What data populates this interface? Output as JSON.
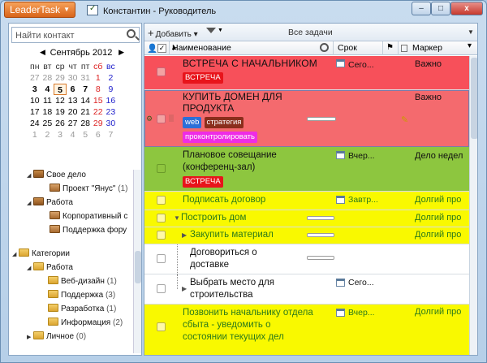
{
  "app": {
    "name": "LeaderTask",
    "window_title": "Константин - Руководитель"
  },
  "window_controls": {
    "minimize": "–",
    "maximize": "□",
    "close": "x"
  },
  "left_panel": {
    "search_placeholder": "Найти контакт",
    "calendar": {
      "month": "Сентябрь 2012",
      "weekdays": [
        "пн",
        "вт",
        "ср",
        "чт",
        "пт",
        "сб",
        "вс"
      ],
      "weeks": [
        [
          "27",
          "28",
          "29",
          "30",
          "31",
          "1",
          "2"
        ],
        [
          "3",
          "4",
          "5",
          "6",
          "7",
          "8",
          "9"
        ],
        [
          "10",
          "11",
          "12",
          "13",
          "14",
          "15",
          "16"
        ],
        [
          "17",
          "18",
          "19",
          "20",
          "21",
          "22",
          "23"
        ],
        [
          "24",
          "25",
          "26",
          "27",
          "28",
          "29",
          "30"
        ],
        [
          "1",
          "2",
          "3",
          "4",
          "5",
          "6",
          "7"
        ]
      ]
    },
    "tree": [
      {
        "label": "Свое дело",
        "count": ""
      },
      {
        "label": "Проект \"Янус\"",
        "count": "(1)"
      },
      {
        "label": "Работа",
        "count": ""
      },
      {
        "label": "Корпоративный с",
        "count": ""
      },
      {
        "label": "Поддержка фору",
        "count": ""
      },
      {
        "label": "Категории",
        "count": ""
      },
      {
        "label": "Работа",
        "count": ""
      },
      {
        "label": "Веб-дизайн",
        "count": "(1)"
      },
      {
        "label": "Поддержка",
        "count": "(3)"
      },
      {
        "label": "Разработка",
        "count": "(1)"
      },
      {
        "label": "Информация",
        "count": "(2)"
      },
      {
        "label": "Личное",
        "count": "(0)"
      }
    ]
  },
  "toolbar": {
    "add_label": "Добавить",
    "view_title": "Все задачи"
  },
  "columns": {
    "name": "Наименование",
    "due": "Срок",
    "marker": "Маркер"
  },
  "tasks": [
    {
      "title": "ВСТРЕЧА С НАЧАЛЬНИКОМ",
      "due": "Сего...",
      "marker": "Важно",
      "tags": [
        "ВСТРЕЧА"
      ]
    },
    {
      "title_line1": "КУПИТЬ ДОМЕН ДЛЯ",
      "title_line2": "ПРОДУКТА",
      "due": "",
      "marker": "Важно",
      "tags": [
        "web",
        "стратегия",
        "проконтролировать"
      ]
    },
    {
      "title_line1": "Плановое совещание",
      "title_line2": "(конференц-зал)",
      "due": "Вчер...",
      "marker": "Дело недел",
      "tags": [
        "ВСТРЕЧА"
      ]
    },
    {
      "title": "Подписать договор",
      "due": "Завтр...",
      "marker": "Долгий про"
    },
    {
      "title": "Построить дом",
      "due": "",
      "marker": "Долгий про"
    },
    {
      "title": "Закупить материал",
      "due": "",
      "marker": "Долгий про"
    },
    {
      "title_line1": "Договориться о",
      "title_line2": "доставке",
      "due": "",
      "marker": ""
    },
    {
      "title_line1": "Выбрать место для",
      "title_line2": "строительства",
      "due": "Сего...",
      "marker": ""
    },
    {
      "title_line1": "Позвонить начальнику отдела",
      "title_line2": "сбыта - уведомить о",
      "title_line3": "состоянии текущих дел",
      "due": "Вчер...",
      "marker": "Долгий про"
    }
  ],
  "colors": {
    "red_row": "#f7505a",
    "green_row": "#8dc63f",
    "yellow_row": "#f9f900",
    "accent_orange": "#e07427"
  }
}
